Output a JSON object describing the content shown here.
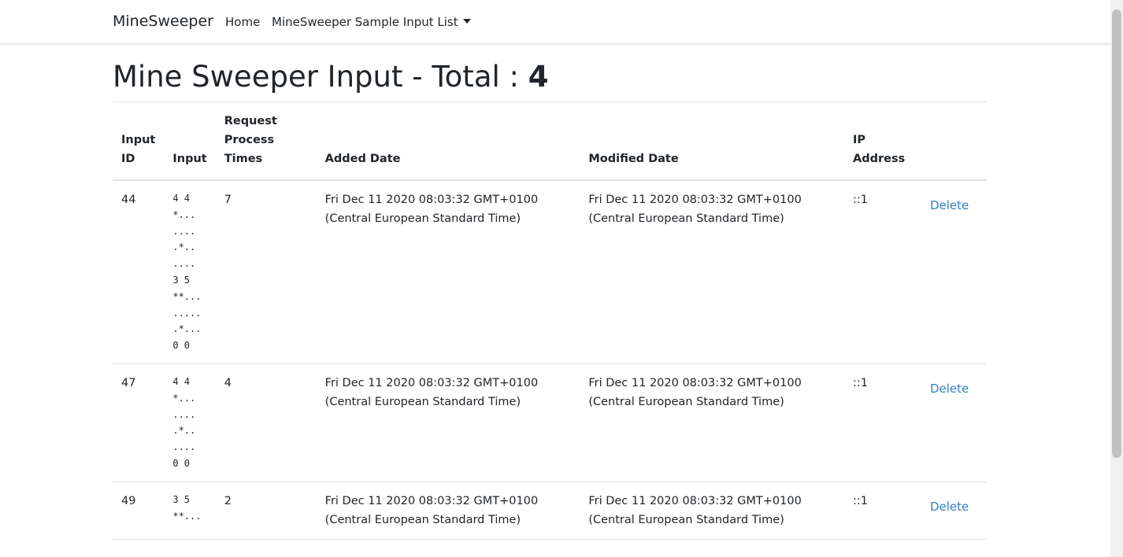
{
  "navbar": {
    "brand": "MineSweeper",
    "links": {
      "home": "Home",
      "sample_list": "MineSweeper Sample Input List"
    }
  },
  "page": {
    "title_prefix": "Mine Sweeper Input - Total : ",
    "total": "4"
  },
  "table": {
    "headers": {
      "input_id": [
        "Input",
        "ID"
      ],
      "input": [
        "Input"
      ],
      "times": [
        "Request",
        "Process",
        "Times"
      ],
      "added": [
        "Added Date"
      ],
      "modified": [
        "Modified Date"
      ],
      "ip": [
        "IP",
        "Address"
      ]
    },
    "rows": [
      {
        "id": "44",
        "input": "4 4\n*...\n....\n.*..\n....\n3 5\n**...\n.....\n.*...\n0 0",
        "times": "7",
        "added": "Fri Dec 11 2020 08:03:32 GMT+0100 (Central European Standard Time)",
        "modified": "Fri Dec 11 2020 08:03:32 GMT+0100 (Central European Standard Time)",
        "ip": "::1",
        "action": "Delete"
      },
      {
        "id": "47",
        "input": "4 4\n*...\n....\n.*..\n....\n0 0",
        "times": "4",
        "added": "Fri Dec 11 2020 08:03:32 GMT+0100 (Central European Standard Time)",
        "modified": "Fri Dec 11 2020 08:03:32 GMT+0100 (Central European Standard Time)",
        "ip": "::1",
        "action": "Delete"
      },
      {
        "id": "49",
        "input": "3 5\n**...",
        "times": "2",
        "added": "Fri Dec 11 2020 08:03:32 GMT+0100 (Central European Standard Time)",
        "modified": "Fri Dec 11 2020 08:03:32 GMT+0100 (Central European Standard Time)",
        "ip": "::1",
        "action": "Delete"
      }
    ]
  },
  "colors": {
    "link": "#2f7fc7",
    "text": "#212529",
    "border": "#dee2e6"
  }
}
